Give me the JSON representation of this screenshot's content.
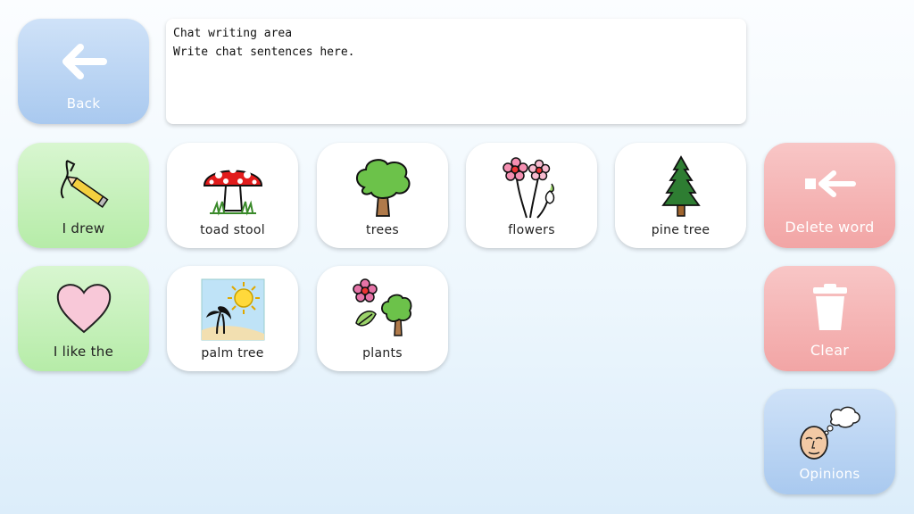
{
  "chat": {
    "line1": "Chat writing area",
    "line2": "Write chat sentences here."
  },
  "nav": {
    "back": {
      "label": "Back",
      "icon": "arrow-left-icon"
    },
    "delete_word": {
      "label": "Delete word",
      "icon": "delete-arrow-icon"
    },
    "clear": {
      "label": "Clear",
      "icon": "trash-icon"
    },
    "opinions": {
      "label": "Opinions",
      "icon": "thinking-face-icon"
    }
  },
  "phrases": [
    {
      "label": "I drew",
      "icon": "pencil-drawing-icon"
    },
    {
      "label": "I like the",
      "icon": "heart-icon"
    }
  ],
  "words": [
    {
      "label": "toad stool",
      "icon": "mushroom-icon"
    },
    {
      "label": "trees",
      "icon": "tree-icon"
    },
    {
      "label": "flowers",
      "icon": "flowers-icon"
    },
    {
      "label": "pine tree",
      "icon": "pine-tree-icon"
    },
    {
      "label": "palm tree",
      "icon": "palm-tree-icon"
    },
    {
      "label": "plants",
      "icon": "plants-icon"
    }
  ],
  "colors": {
    "phrase_tile": "#b6eca8",
    "nav_tile": "#a9c9ef",
    "delete_tile": "#f2a5a5",
    "word_tile": "#ffffff"
  }
}
